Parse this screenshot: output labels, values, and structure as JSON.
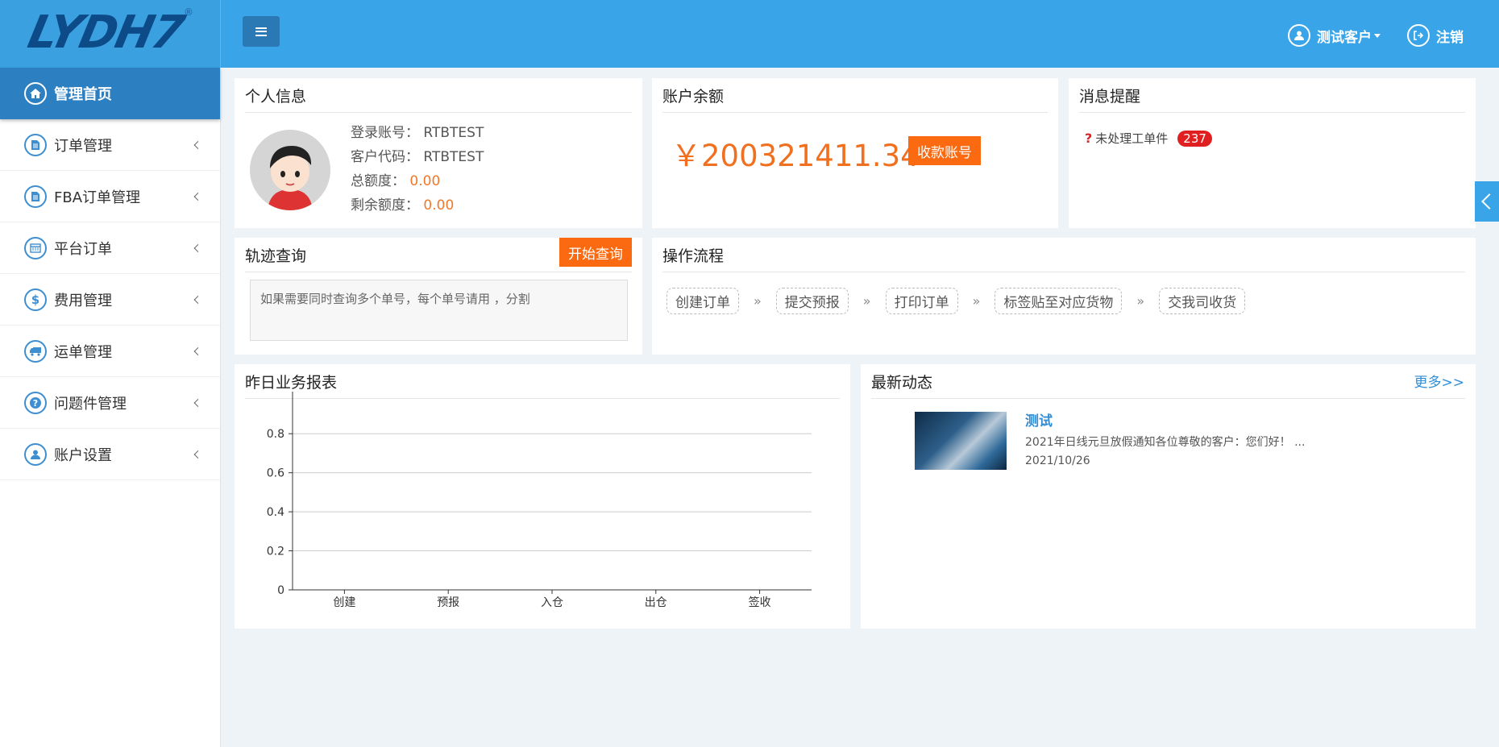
{
  "header": {
    "logo_text": "LYDH7",
    "logo_reg": "®",
    "user_label": "测试客户",
    "logout_label": "注销"
  },
  "sidebar": {
    "items": [
      {
        "label": "管理首页",
        "icon": "home-icon"
      },
      {
        "label": "订单管理",
        "icon": "document-icon"
      },
      {
        "label": "FBA订单管理",
        "icon": "document-icon"
      },
      {
        "label": "平台订单",
        "icon": "calendar-icon"
      },
      {
        "label": "费用管理",
        "icon": "dollar-icon"
      },
      {
        "label": "运单管理",
        "icon": "truck-icon"
      },
      {
        "label": "问题件管理",
        "icon": "question-icon"
      },
      {
        "label": "账户设置",
        "icon": "user-icon"
      }
    ]
  },
  "personal_info": {
    "title": "个人信息",
    "login_label": "登录账号：",
    "login_value": "RTBTEST",
    "code_label": "客户代码：",
    "code_value": "RTBTEST",
    "total_label": "总额度：",
    "total_value": "0.00",
    "remain_label": "剩余额度：",
    "remain_value": "0.00"
  },
  "balance": {
    "title": "账户余额",
    "amount": "￥200321411.34",
    "button": "收款账号"
  },
  "messages": {
    "title": "消息提醒",
    "item_label": "未处理工单件",
    "item_count": "237"
  },
  "tracking": {
    "title": "轨迹查询",
    "button": "开始查询",
    "placeholder": "如果需要同时查询多个单号，每个单号请用 ，分割"
  },
  "workflow": {
    "title": "操作流程",
    "steps": [
      "创建订单",
      "提交预报",
      "打印订单",
      "标签贴至对应货物",
      "交我司收货"
    ],
    "separator": "»"
  },
  "report": {
    "title": "昨日业务报表"
  },
  "chart_data": {
    "type": "bar",
    "categories": [
      "创建",
      "预报",
      "入仓",
      "出仓",
      "签收"
    ],
    "values": [
      0,
      0,
      0,
      0,
      0
    ],
    "yticks": [
      "0",
      "0.2",
      "0.4",
      "0.6",
      "0.8"
    ],
    "ylim": [
      0,
      0.9
    ],
    "grid": true
  },
  "news": {
    "title": "最新动态",
    "more": "更多>>",
    "item_title": "测试",
    "item_desc": "2021年日线元旦放假通知各位尊敬的客户：您们好！ ...",
    "item_date": "2021/10/26"
  }
}
